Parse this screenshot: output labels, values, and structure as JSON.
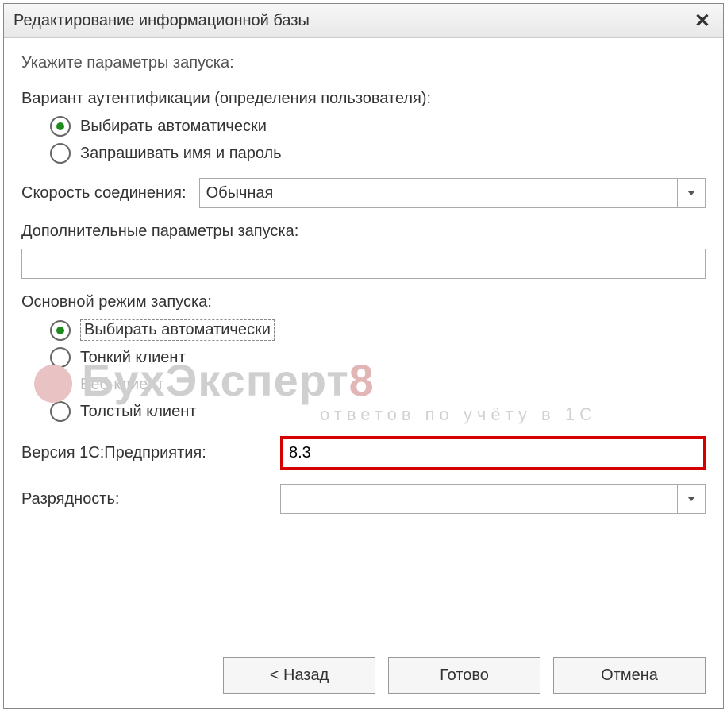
{
  "title": "Редактирование информационной базы",
  "instruction": "Укажите параметры запуска:",
  "auth": {
    "group_label": "Вариант аутентификации (определения пользователя):",
    "options": {
      "auto": "Выбирать автоматически",
      "prompt": "Запрашивать имя и пароль"
    },
    "selected": "auto"
  },
  "speed": {
    "label": "Скорость соединения:",
    "value": "Обычная"
  },
  "extra": {
    "label": "Дополнительные параметры запуска:",
    "value": ""
  },
  "mode": {
    "group_label": "Основной режим запуска:",
    "options": {
      "auto": "Выбирать автоматически",
      "thin": "Тонкий клиент",
      "web": "Веб-клиент",
      "thick": "Толстый клиент"
    },
    "selected": "auto",
    "disabled": "web"
  },
  "version": {
    "label": "Версия 1С:Предприятия:",
    "value": "8.3"
  },
  "bitness": {
    "label": "Разрядность:",
    "value": ""
  },
  "buttons": {
    "back": "< Назад",
    "finish": "Готово",
    "cancel": "Отмена"
  },
  "watermark": {
    "main_a": "БухЭксперт",
    "main_b": "8",
    "sub": "ответов по учёту в 1С"
  }
}
